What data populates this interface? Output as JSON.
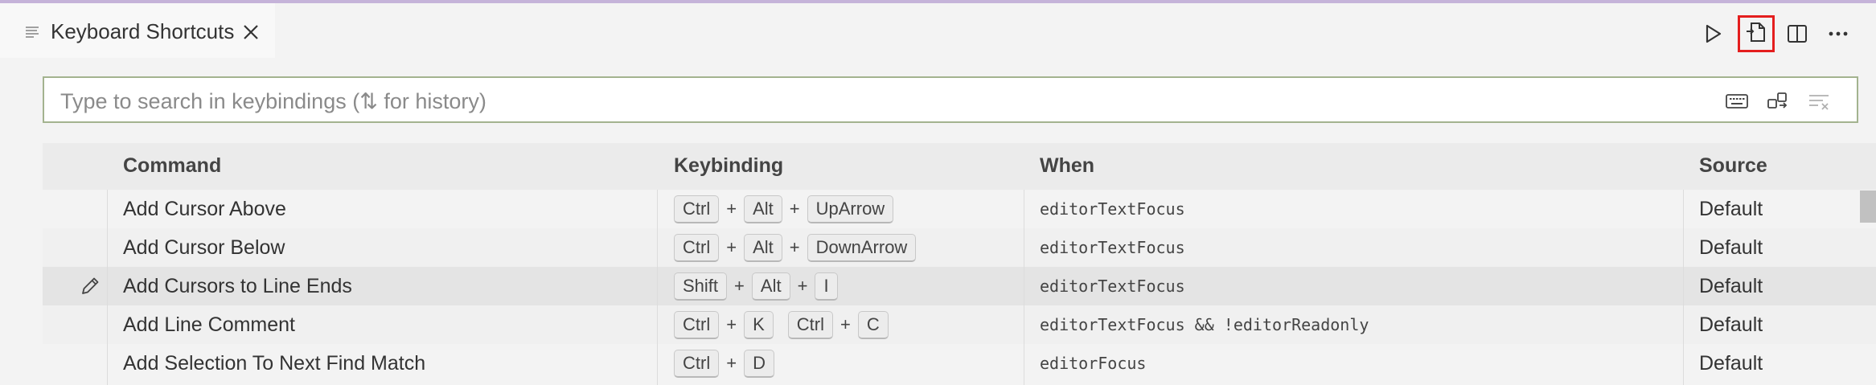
{
  "tab": {
    "title": "Keyboard Shortcuts",
    "file_icon": "list-icon",
    "close_icon": "close-icon"
  },
  "toolbar": {
    "run_icon": "play-icon",
    "open_json_icon": "open-file-icon",
    "split_icon": "split-editor-icon",
    "more_icon": "more-icon",
    "highlight_color": "#e41e1e"
  },
  "search": {
    "placeholder": "Type to search in keybindings (⇅ for history)",
    "value": "",
    "record_keys_icon": "keyboard-icon",
    "sort_icon": "sort-by-precedence-icon",
    "clear_icon": "clear-filter-icon"
  },
  "table": {
    "headers": {
      "command": "Command",
      "keybinding": "Keybinding",
      "when": "When",
      "source": "Source"
    },
    "rows": [
      {
        "command": "Add Cursor Above",
        "chords": [
          [
            "Ctrl",
            "Alt",
            "UpArrow"
          ]
        ],
        "when": "editorTextFocus",
        "source": "Default"
      },
      {
        "command": "Add Cursor Below",
        "chords": [
          [
            "Ctrl",
            "Alt",
            "DownArrow"
          ]
        ],
        "when": "editorTextFocus",
        "source": "Default"
      },
      {
        "command": "Add Cursors to Line Ends",
        "chords": [
          [
            "Shift",
            "Alt",
            "I"
          ]
        ],
        "when": "editorTextFocus",
        "source": "Default",
        "edit_icon": "edit-icon"
      },
      {
        "command": "Add Line Comment",
        "chords": [
          [
            "Ctrl",
            "K"
          ],
          [
            "Ctrl",
            "C"
          ]
        ],
        "when": "editorTextFocus && !editorReadonly",
        "source": "Default"
      },
      {
        "command": "Add Selection To Next Find Match",
        "chords": [
          [
            "Ctrl",
            "D"
          ]
        ],
        "when": "editorFocus",
        "source": "Default"
      }
    ]
  }
}
